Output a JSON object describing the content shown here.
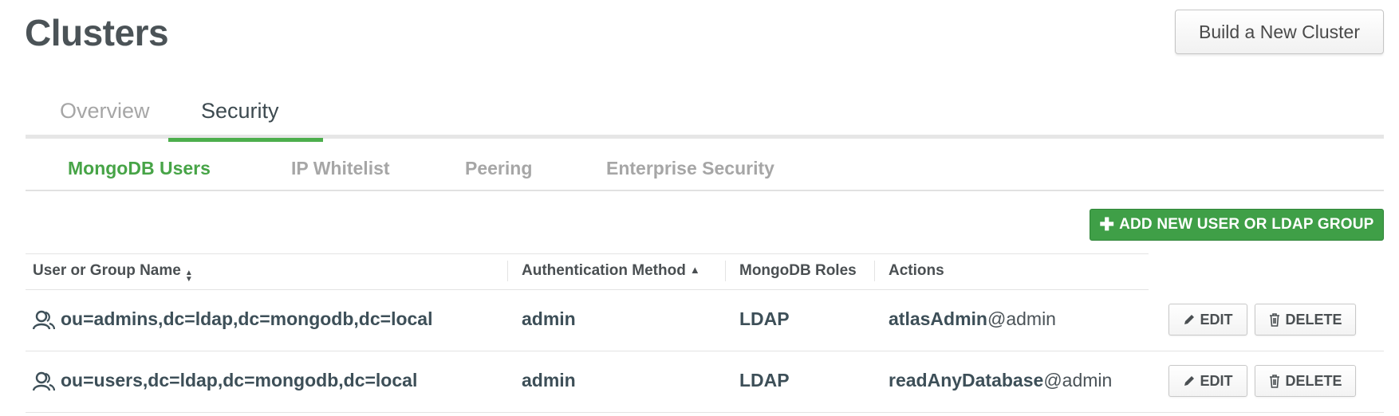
{
  "page": {
    "title": "Clusters"
  },
  "header": {
    "build_button": "Build a New Cluster"
  },
  "main_tabs": [
    {
      "label": "Overview",
      "active": false
    },
    {
      "label": "Security",
      "active": true
    }
  ],
  "sub_tabs": [
    {
      "label": "MongoDB Users",
      "active": true
    },
    {
      "label": "IP Whitelist",
      "active": false
    },
    {
      "label": "Peering",
      "active": false
    },
    {
      "label": "Enterprise Security",
      "active": false
    }
  ],
  "add_button": {
    "icon": "plus-icon",
    "label": "ADD NEW USER OR LDAP GROUP"
  },
  "table": {
    "columns": [
      {
        "label": "User or Group Name",
        "sort_icon": "sort-both-icon"
      },
      {
        "label": "Authentication Method",
        "sort_icon": "sort-asc-icon"
      },
      {
        "label": "MongoDB Roles"
      },
      {
        "label": "Actions"
      }
    ],
    "rows": [
      {
        "icon": "group-icon",
        "name": "ou=admins,dc=ldap,dc=mongodb,dc=local",
        "auth_db": "admin",
        "method": "LDAP",
        "role": "atlasAdmin",
        "role_suffix": "@admin",
        "edit_label": "EDIT",
        "delete_label": "DELETE"
      },
      {
        "icon": "group-icon",
        "name": "ou=users,dc=ldap,dc=mongodb,dc=local",
        "auth_db": "admin",
        "method": "LDAP",
        "role": "readAnyDatabase",
        "role_suffix": "@admin",
        "edit_label": "EDIT",
        "delete_label": "DELETE"
      }
    ]
  },
  "colors": {
    "accent_green": "#47a447",
    "button_green": "#3f9f47",
    "title_gray": "#4b5357"
  }
}
